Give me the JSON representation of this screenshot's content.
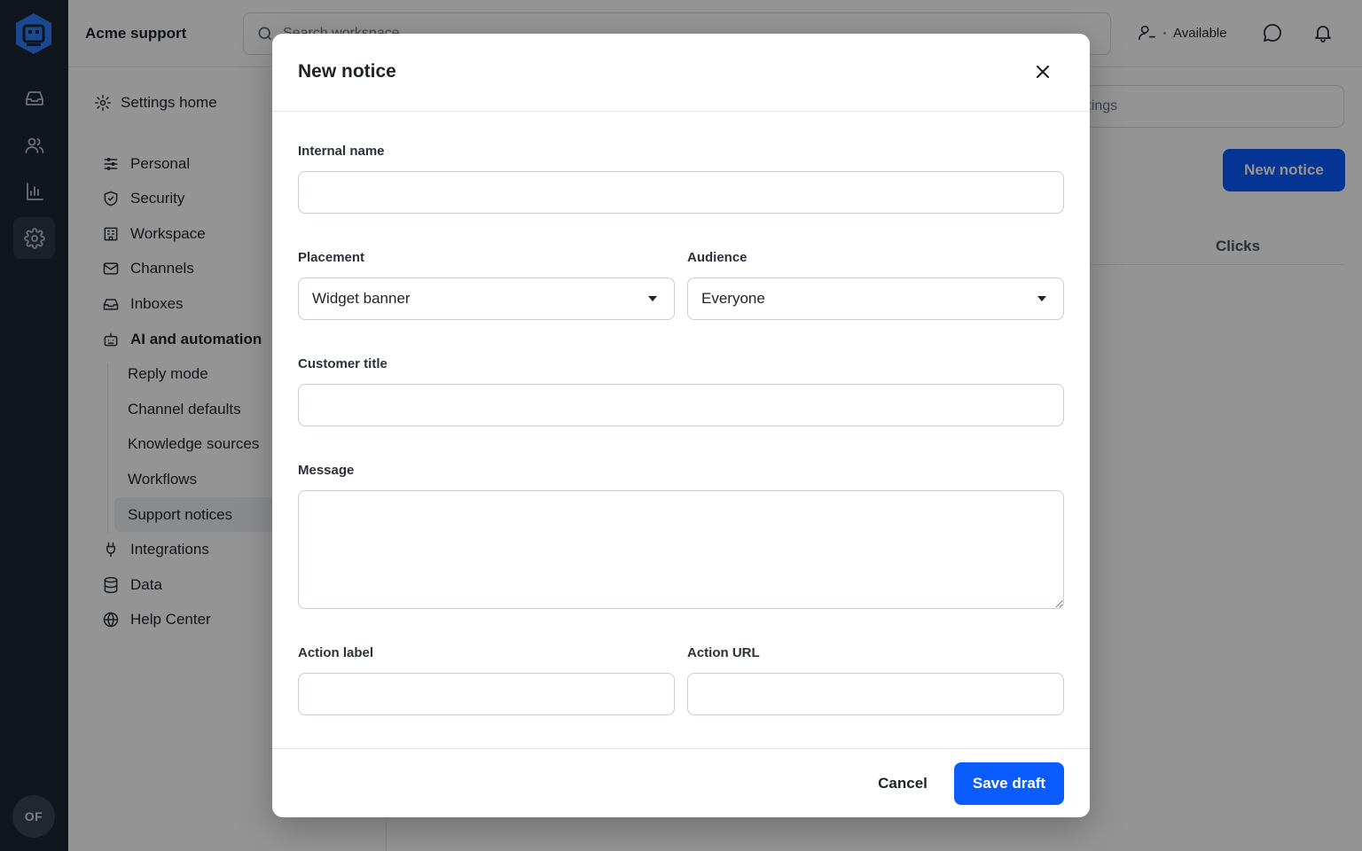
{
  "app": {
    "workspace_name": "Acme support",
    "avatar_initials": "OF"
  },
  "rail": {
    "items": [
      {
        "icon": "inbox-icon"
      },
      {
        "icon": "people-icon"
      },
      {
        "icon": "bar-chart-icon"
      },
      {
        "icon": "gear-icon",
        "active": true
      }
    ]
  },
  "header": {
    "search_placeholder": "Search workspace",
    "status_label": "Available"
  },
  "settings_nav": {
    "home_label": "Settings home",
    "items": [
      {
        "label": "Personal",
        "icon": "sliders-icon"
      },
      {
        "label": "Security",
        "icon": "shield-icon"
      },
      {
        "label": "Workspace",
        "icon": "building-icon"
      },
      {
        "label": "Channels",
        "icon": "mail-icon"
      },
      {
        "label": "Inboxes",
        "icon": "inbox-icon"
      },
      {
        "label": "AI and automation",
        "icon": "robot-icon"
      },
      {
        "label": "Integrations",
        "icon": "plug-icon"
      },
      {
        "label": "Data",
        "icon": "database-icon"
      },
      {
        "label": "Help Center",
        "icon": "globe-icon"
      }
    ],
    "sub_items": [
      "Reply mode",
      "Channel defaults",
      "Knowledge sources",
      "Workflows",
      "Support notices"
    ],
    "active_sub_item": "Support notices"
  },
  "main": {
    "filter_placeholder": "ettings",
    "new_button_label": "New notice",
    "column_clicks": "Clicks"
  },
  "modal": {
    "title": "New notice",
    "internal_name": {
      "label": "Internal name",
      "value": ""
    },
    "placement": {
      "label": "Placement",
      "value": "Widget banner"
    },
    "audience": {
      "label": "Audience",
      "value": "Everyone"
    },
    "customer_title": {
      "label": "Customer title",
      "value": ""
    },
    "message": {
      "label": "Message",
      "value": ""
    },
    "action_label": {
      "label": "Action label",
      "value": ""
    },
    "action_url": {
      "label": "Action URL",
      "value": ""
    },
    "cancel_label": "Cancel",
    "save_label": "Save draft"
  },
  "colors": {
    "rail_bg": "#1c2534",
    "primary": "#0a5cff",
    "overlay": "rgba(0,0,0,0.42)"
  }
}
